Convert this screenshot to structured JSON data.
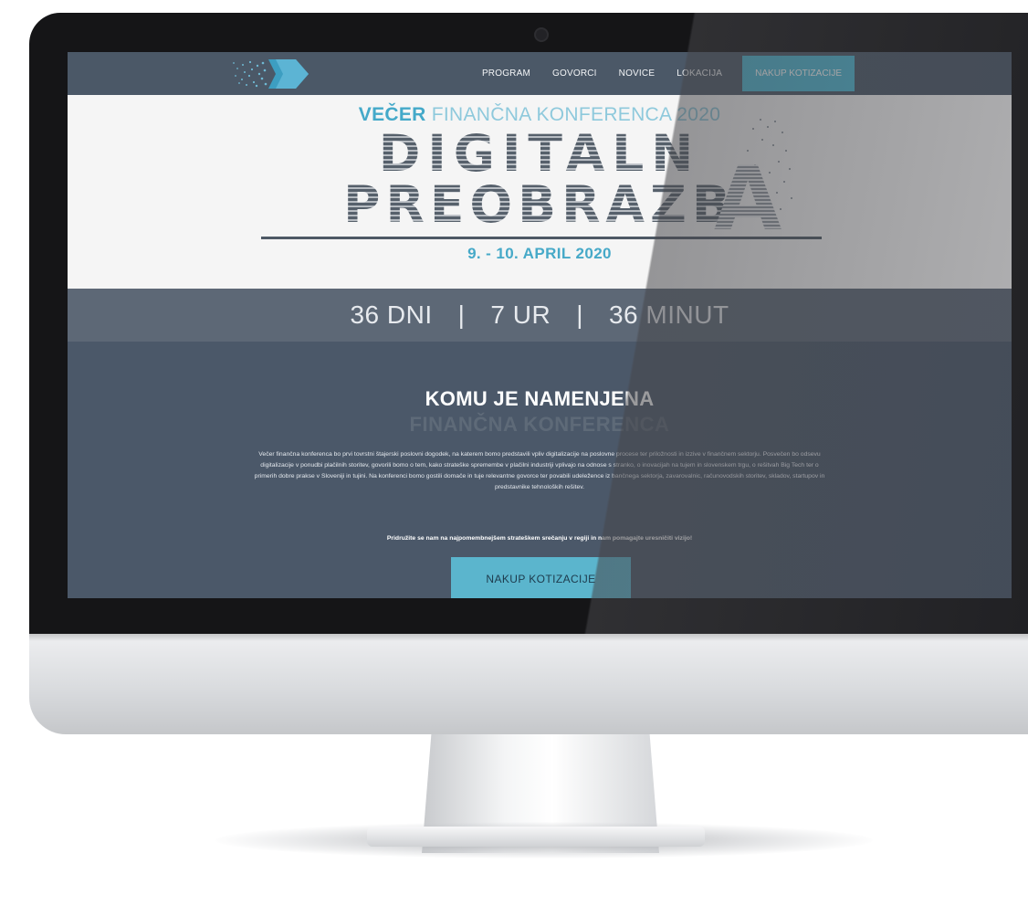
{
  "nav": {
    "items": [
      {
        "label": "PROGRAM"
      },
      {
        "label": "GOVORCI"
      },
      {
        "label": "NOVICE"
      },
      {
        "label": "LOKACIJA"
      }
    ],
    "cta_label": "NAKUP KOTIZACIJE"
  },
  "hero": {
    "kicker_brand": "VEČER",
    "kicker_rest": "FINANČNA KONFERENCA 2020",
    "title_line1": "DIGITALN",
    "title_line2": "PREOBRAZB",
    "title_ghost_letter": "A",
    "date": "9. - 10. APRIL 2020"
  },
  "countdown": {
    "days": "36 DNI",
    "hours": "7 UR",
    "minutes": "36 MINUT",
    "separator": "|"
  },
  "about": {
    "heading": "KOMU JE NAMENJENA",
    "subheading": "FINANČNA KONFERENCA",
    "body": "Večer finančna konferenca bo prvi tovrstni štajerski poslovni dogodek, na katerem bomo predstavili vpliv digitalizacije na poslovne procese ter priložnosti in izzive v finančnem sektorju. Posvečen bo odsevu digitalizacije v ponudbi plačilnih storitev, govorili bomo o tem, kako strateške spremembe v plačilni industriji vplivajo na odnose s stranko, o inovacijah na tujem in slovenskem trgu, o rešitvah Big Tech ter o primerih dobre prakse v Sloveniji in tujini. Na konferenci bomo gostili domače in tuje relevantne govorce ter povabili udeležence iz bančnega sektorja, zavarovalnic, računovodskih storitev, skladov, startupov in predstavnike tehnoloških rešitev.",
    "bold_line": "Pridružite se nam na najpomembnejšem strateškem srečanju v regiji in nam pomagajte uresničiti vizijo!",
    "cta_label": "NAKUP KOTIZACIJE"
  },
  "colors": {
    "accent": "#4db7d2",
    "nav_bg": "#4b5867",
    "section_bg": "#4b5869",
    "title_gray": "#56606b"
  },
  "icons": {
    "logo": "pixel-arrow-logo",
    "camera": "camera-dot"
  }
}
